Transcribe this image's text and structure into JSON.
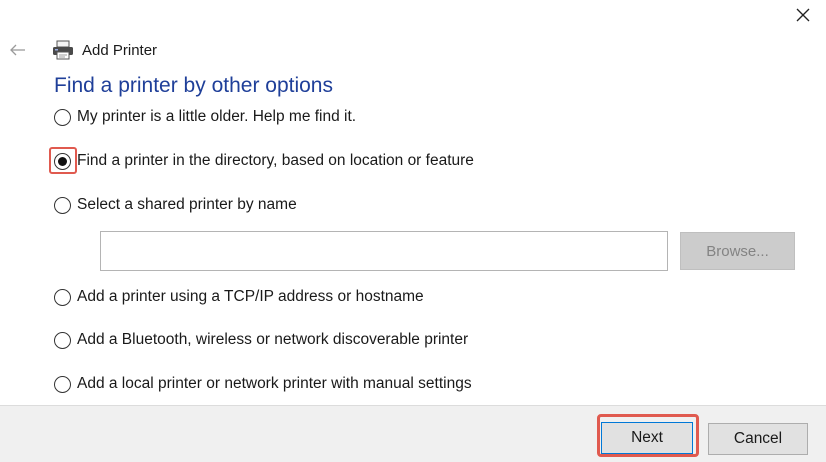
{
  "window": {
    "title": "Add Printer",
    "close_icon": "close-icon",
    "back_icon": "back-arrow-icon",
    "printer_icon": "printer-icon"
  },
  "page": {
    "heading": "Find a printer by other options"
  },
  "options": [
    {
      "label": "My printer is a little older. Help me find it.",
      "selected": false
    },
    {
      "label": "Find a printer in the directory, based on location or feature",
      "selected": true
    },
    {
      "label": "Select a shared printer by name",
      "selected": false
    },
    {
      "label": "Add a printer using a TCP/IP address or hostname",
      "selected": false
    },
    {
      "label": "Add a Bluetooth, wireless or network discoverable printer",
      "selected": false
    },
    {
      "label": "Add a local printer or network printer with manual settings",
      "selected": false
    }
  ],
  "shared_printer": {
    "value": "",
    "browse_label": "Browse..."
  },
  "footer": {
    "next_label": "Next",
    "cancel_label": "Cancel"
  },
  "colors": {
    "heading": "#1f3f99",
    "highlight": "#e05a4f",
    "footer_bg": "#f0f0f0"
  }
}
